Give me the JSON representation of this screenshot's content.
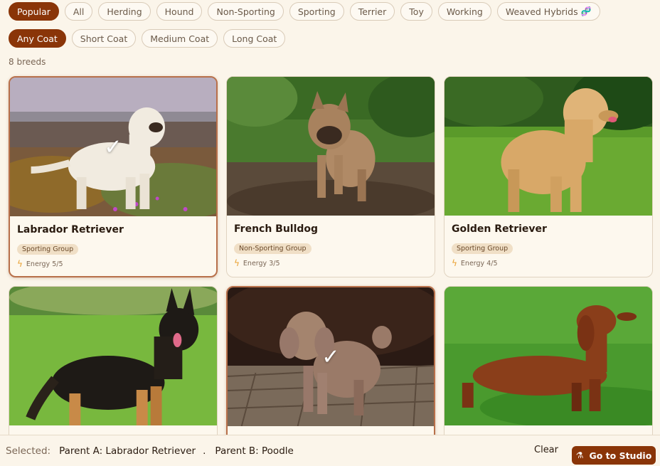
{
  "filters": {
    "groups": [
      "Popular",
      "All",
      "Herding",
      "Hound",
      "Non-Sporting",
      "Sporting",
      "Terrier",
      "Toy",
      "Working",
      "Weaved Hybrids"
    ],
    "active_group": "Popular",
    "coats": [
      "Any Coat",
      "Short Coat",
      "Medium Coat",
      "Long Coat"
    ],
    "active_coat": "Any Coat"
  },
  "count_label": "8 breeds",
  "breeds": [
    {
      "name": "Labrador Retriever",
      "group": "Sporting Group",
      "energy": "Energy 5/5",
      "selected": true,
      "check": "✓"
    },
    {
      "name": "French Bulldog",
      "group": "Non-Sporting Group",
      "energy": "Energy 3/5",
      "selected": false
    },
    {
      "name": "Golden Retriever",
      "group": "Sporting Group",
      "energy": "Energy 4/5",
      "selected": false
    },
    {
      "name": "",
      "selected": false
    },
    {
      "name": "",
      "selected": true,
      "check": "✓"
    },
    {
      "name": "",
      "selected": false
    }
  ],
  "bottom_bar": {
    "selected_label": "Selected:",
    "parent_a": "Parent A: Labrador Retriever",
    "separator": ".",
    "parent_b": "Parent B: Poodle",
    "clear_label": "Clear",
    "studio_label": "Go to Studio"
  },
  "colors": {
    "accent": "#8a3508",
    "background": "#fbf5ea"
  }
}
